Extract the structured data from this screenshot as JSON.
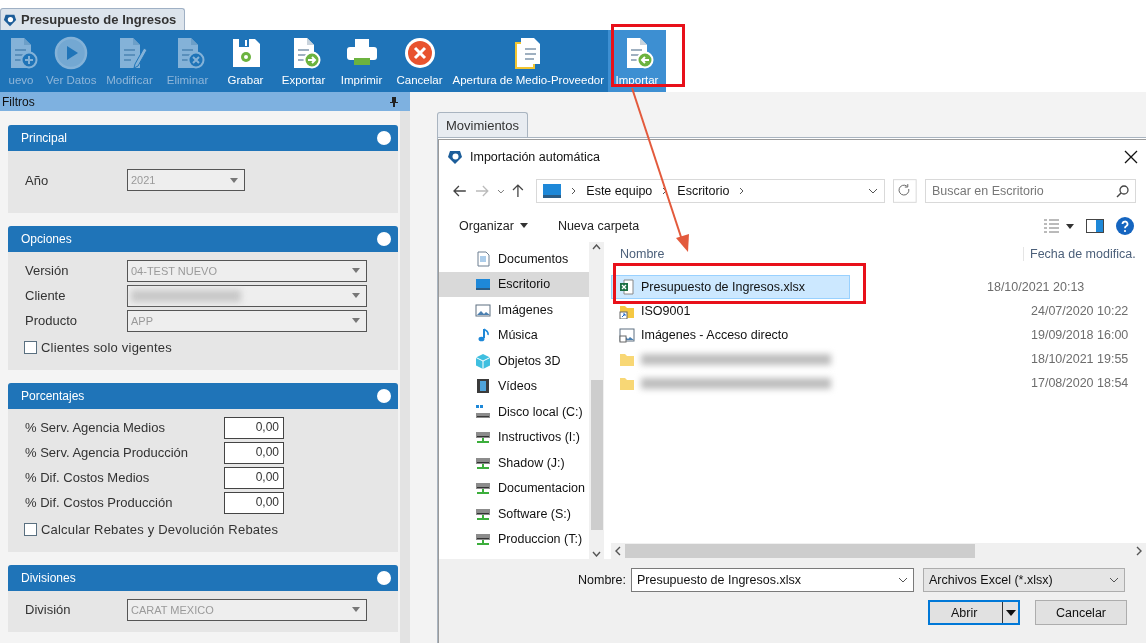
{
  "app_tab": {
    "title": "Presupuesto de Ingresos"
  },
  "toolbar": [
    {
      "label": "uevo",
      "kind": "new",
      "disabled": true,
      "selected": false
    },
    {
      "label": "Ver Datos",
      "kind": "view",
      "disabled": true,
      "selected": false
    },
    {
      "label": "Modificar",
      "kind": "edit",
      "disabled": true,
      "selected": false
    },
    {
      "label": "Eliminar",
      "kind": "delete",
      "disabled": true,
      "selected": false
    },
    {
      "label": "Grabar",
      "kind": "save",
      "disabled": false,
      "selected": false
    },
    {
      "label": "Exportar",
      "kind": "export",
      "disabled": false,
      "selected": false
    },
    {
      "label": "Imprimir",
      "kind": "print",
      "disabled": false,
      "selected": false
    },
    {
      "label": "Cancelar",
      "kind": "cancel",
      "disabled": false,
      "selected": false
    },
    {
      "label": "Apertura de Medio-Proveedor",
      "kind": "open_docs",
      "disabled": false,
      "selected": false
    },
    {
      "label": "Importar",
      "kind": "import",
      "disabled": false,
      "selected": true
    }
  ],
  "filters": {
    "title": "Filtros",
    "sections": [
      {
        "title": "Principal",
        "items": [
          {
            "kind": "select",
            "label": "Año",
            "value": "2021",
            "disabled": true
          }
        ]
      },
      {
        "title": "Opciones",
        "items": [
          {
            "kind": "select",
            "label": "Versión",
            "value": "04-TEST NUEVO",
            "disabled": true
          },
          {
            "kind": "select",
            "label": "Cliente",
            "disabled": true
          },
          {
            "kind": "select",
            "label": "Producto",
            "value": "APP",
            "disabled": true
          },
          {
            "kind": "checkbox",
            "label": "Clientes solo vigentes",
            "checked": false
          }
        ]
      },
      {
        "title": "Porcentajes",
        "items": [
          {
            "kind": "number",
            "label": "% Serv. Agencia Medios",
            "value": "0,00"
          },
          {
            "kind": "number",
            "label": "% Serv. Agencia Producción",
            "value": "0,00"
          },
          {
            "kind": "number",
            "label": "% Dif. Costos Medios",
            "value": "0,00"
          },
          {
            "kind": "number",
            "label": "% Dif. Costos Producción",
            "value": "0,00"
          },
          {
            "kind": "checkbox",
            "label": "Calcular Rebates y Devolución Rebates",
            "checked": false
          }
        ]
      },
      {
        "title": "Divisiones",
        "items": [
          {
            "kind": "select",
            "label": "División",
            "value": "CARAT MEXICO",
            "disabled": true
          }
        ]
      }
    ]
  },
  "content_tabs": [
    {
      "label": "Movimientos",
      "selected": true
    }
  ],
  "dialog": {
    "title": "Importación automática",
    "breadcrumb": [
      "Este equipo",
      "Escritorio"
    ],
    "search": {
      "placeholder": "Buscar en Escritorio"
    },
    "commands": [
      {
        "label": "Organizar",
        "kind": "menu"
      },
      {
        "label": "Nueva carpeta",
        "kind": "button"
      }
    ],
    "nav": [
      {
        "label": "Documentos",
        "kind": "documents",
        "selected": false
      },
      {
        "label": "Escritorio",
        "kind": "desktop",
        "selected": true
      },
      {
        "label": "Imágenes",
        "kind": "pictures",
        "selected": false
      },
      {
        "label": "Música",
        "kind": "music",
        "selected": false
      },
      {
        "label": "Objetos 3D",
        "kind": "cube",
        "selected": false
      },
      {
        "label": "Vídeos",
        "kind": "videos",
        "selected": false
      },
      {
        "label": "Disco local (C:)",
        "kind": "disk",
        "selected": false
      },
      {
        "label": "Instructivos (I:)",
        "kind": "netdrive",
        "selected": false
      },
      {
        "label": "Shadow (J:)",
        "kind": "netdrive",
        "selected": false
      },
      {
        "label": "Documentacion",
        "kind": "netdrive",
        "selected": false
      },
      {
        "label": "Software (S:)",
        "kind": "netdrive",
        "selected": false
      },
      {
        "label": "Produccion (T:)",
        "kind": "netdrive",
        "selected": false
      }
    ],
    "columns": [
      "Nombre",
      "Fecha de modifica."
    ],
    "files": [
      {
        "name": "Presupuesto de Ingresos.xlsx",
        "date": "18/10/2021 20:13",
        "kind": "excel",
        "selected": true
      },
      {
        "name": "ISO9001",
        "date": "24/07/2020 10:22",
        "kind": "folder_link",
        "selected": false
      },
      {
        "name": "Imágenes - Acceso directo",
        "date": "19/09/2018 16:00",
        "kind": "shortcut",
        "selected": false
      },
      {
        "date": "18/10/2021 19:55",
        "kind": "folder",
        "selected": false
      },
      {
        "date": "17/08/2020 18:54",
        "kind": "folder",
        "selected": false
      }
    ],
    "filename": {
      "label": "Nombre:",
      "value": "Presupuesto de Ingresos.xlsx"
    },
    "filetype": {
      "value": "Archivos Excel (*.xlsx)"
    },
    "buttons": [
      {
        "label": "Abrir",
        "kind": "split"
      },
      {
        "label": "Cancelar",
        "kind": "plain"
      }
    ]
  }
}
